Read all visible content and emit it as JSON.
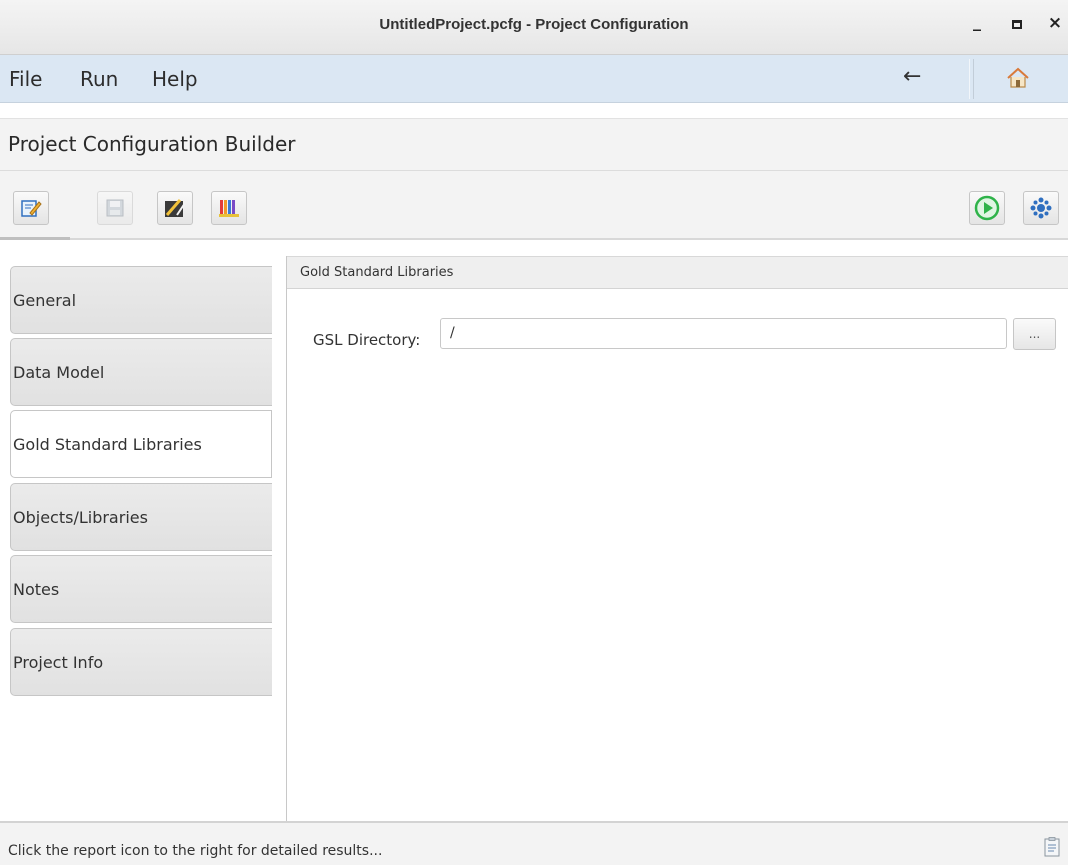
{
  "window": {
    "title": "UntitledProject.pcfg - Project Configuration",
    "minimize": "_",
    "close": "×"
  },
  "menu": {
    "items": [
      "File",
      "Run",
      "Help"
    ],
    "back": "←",
    "home_icon": "home-icon"
  },
  "page": {
    "title": "Project Configuration Builder"
  },
  "toolbar": {
    "left_icons": [
      "edit-icon",
      "save-icon",
      "wizard-icon",
      "library-icon"
    ],
    "right_icons": [
      "run-icon",
      "settings-icon"
    ]
  },
  "sidebar": {
    "tabs": [
      "General",
      "Data Model",
      "Gold Standard Libraries",
      "Objects/Libraries",
      "Notes",
      "Project Info"
    ],
    "active": "Gold Standard Libraries"
  },
  "panel": {
    "header": "Gold Standard Libraries",
    "gsl_label": "GSL Directory:",
    "gsl_value": "/",
    "browse_label": "..."
  },
  "status": {
    "text": "Click the report icon to the right for detailed results...",
    "report_icon": "report-icon"
  },
  "colors": {
    "menubar": "#dbe7f3",
    "run_green": "#2fb34a",
    "settings_blue": "#2f6fc0"
  }
}
